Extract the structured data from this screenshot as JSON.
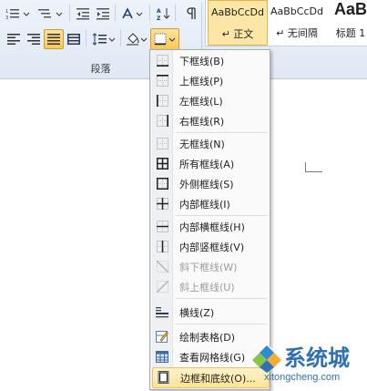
{
  "ribbon": {
    "paragraph_group_label": "段落",
    "styles": [
      {
        "sample": "AaBbCcDd",
        "name": "↵ 正文",
        "selected": true
      },
      {
        "sample": "AaBbCcDd",
        "name": "↵ 无间隔",
        "selected": false
      },
      {
        "sample": "AaB",
        "name": "标题 1",
        "selected": false
      }
    ]
  },
  "border_menu": {
    "items": [
      {
        "label": "下框线(B)",
        "icon": "bottom-border-icon",
        "disabled": false,
        "highlighted": false
      },
      {
        "label": "上框线(P)",
        "icon": "top-border-icon",
        "disabled": false,
        "highlighted": false
      },
      {
        "label": "左框线(L)",
        "icon": "left-border-icon",
        "disabled": false,
        "highlighted": false
      },
      {
        "label": "右框线(R)",
        "icon": "right-border-icon",
        "disabled": false,
        "highlighted": false
      },
      {
        "label": "无框线(N)",
        "icon": "no-border-icon",
        "disabled": false,
        "highlighted": false
      },
      {
        "label": "所有框线(A)",
        "icon": "all-borders-icon",
        "disabled": false,
        "highlighted": false
      },
      {
        "label": "外侧框线(S)",
        "icon": "outside-borders-icon",
        "disabled": false,
        "highlighted": false
      },
      {
        "label": "内部框线(I)",
        "icon": "inside-borders-icon",
        "disabled": false,
        "highlighted": false
      },
      {
        "label": "内部横框线(H)",
        "icon": "inside-horizontal-border-icon",
        "disabled": false,
        "highlighted": false
      },
      {
        "label": "内部竖框线(V)",
        "icon": "inside-vertical-border-icon",
        "disabled": false,
        "highlighted": false
      },
      {
        "label": "斜下框线(W)",
        "icon": "diagonal-down-border-icon",
        "disabled": true,
        "highlighted": false
      },
      {
        "label": "斜上框线(U)",
        "icon": "diagonal-up-border-icon",
        "disabled": true,
        "highlighted": false
      },
      {
        "label": "横线(Z)",
        "icon": "horizontal-line-icon",
        "disabled": false,
        "highlighted": false
      },
      {
        "label": "绘制表格(D)",
        "icon": "draw-table-icon",
        "disabled": false,
        "highlighted": false
      },
      {
        "label": "查看网格线(G)",
        "icon": "view-gridlines-icon",
        "disabled": false,
        "highlighted": false
      },
      {
        "label": "边框和底纹(O)...",
        "icon": "borders-and-shading-icon",
        "disabled": false,
        "highlighted": true
      }
    ]
  },
  "watermark": {
    "title": "系统城",
    "url": "xitongcheng.com"
  }
}
